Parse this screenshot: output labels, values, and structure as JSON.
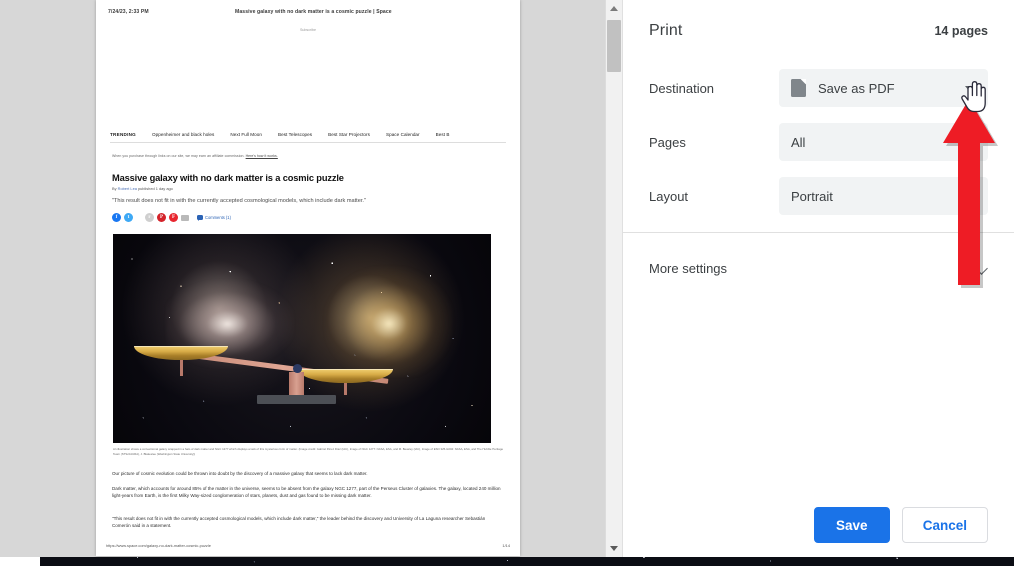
{
  "print_dialog": {
    "title": "Print",
    "page_count": "14 pages",
    "rows": [
      {
        "label": "Destination",
        "value": "Save as PDF",
        "icon": "pdf-document-icon"
      },
      {
        "label": "Pages",
        "value": "All",
        "icon": ""
      },
      {
        "label": "Layout",
        "value": "Portrait",
        "icon": ""
      }
    ],
    "more_settings_label": "More settings",
    "save_label": "Save",
    "cancel_label": "Cancel",
    "accent_color": "#1a73e8",
    "field_background": "#f1f3f4"
  },
  "annotation": {
    "type": "arrow",
    "color": "#ee1c25",
    "points_to": "Destination dropdown"
  },
  "preview": {
    "page_header": {
      "date": "7/24/23, 2:33 PM",
      "doc_title": "Massive galaxy with no dark matter is a cosmic puzzle | Space"
    },
    "subscribe_label": "Subscribe",
    "trending": {
      "label": "TRENDING",
      "items": [
        "Oppenheimer and black holes",
        "Next Full Moon",
        "Best Telescopes",
        "Best Star Projectors",
        "Space Calendar",
        "Best B"
      ]
    },
    "affiliate_note": "When you purchase through links on our site, we may earn an affiliate commission.",
    "affiliate_link": "Here's how it works.",
    "article": {
      "headline": "Massive galaxy with no dark matter is a cosmic puzzle",
      "byline_prefix": "By",
      "byline_author": "Robert Lea",
      "byline_suffix": "published 1 day ago",
      "standfirst": "\"This result does not fit in with the currently accepted cosmological models, which include dark matter.\"",
      "comments_label": "Comments (1)",
      "image_caption": "An illustration shows a conventional galaxy wrapped in a halo of dark matter and NGC 1277 which displays a lack of this mysterious form of matter. (Image credit: Gabriel Pérez Díaz (IAC), Image of NGC 1277: NASA, ESA, and M. Beasley (IAC), Image of ESO 325-G004: NASA, ESA, and The Hubble Heritage Team (STScI/AURA), J. Blakeslee (Washington State University))",
      "paragraphs": [
        "Our picture of cosmic evolution could be thrown into doubt by the discovery of a massive galaxy that seems to lack dark matter.",
        "Dark matter, which accounts for around 85% of the matter in the universe, seems to be absent from the galaxy NGC 1277, part of the Perseus Cluster of galaxies. The galaxy, located 240 million light-years from Earth, is the first Milky Way-sized conglomeration of stars, planets, dust and gas found to be missing dark matter.",
        "\"This result does not fit in with the currently accepted cosmological models, which include dark matter,\" the leader behind the discovery and University of La Laguna researcher Sebastián Comerón said in a statement."
      ]
    },
    "page_footer": {
      "url": "https://www.space.com/galaxy-no-dark-matter-cosmic-puzzle",
      "page_number": "1/14"
    }
  }
}
